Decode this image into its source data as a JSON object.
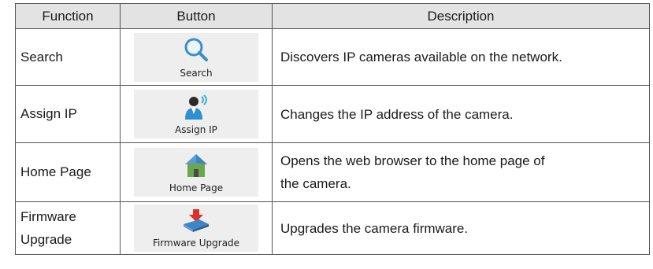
{
  "table": {
    "headers": {
      "function": "Function",
      "button": "Button",
      "description": "Description"
    },
    "rows": [
      {
        "function": "Search",
        "button_label": "Search",
        "icon": "magnifier-icon",
        "description": "Discovers IP cameras available on the network."
      },
      {
        "function": "Assign IP",
        "button_label": "Assign IP",
        "icon": "person-signal-icon",
        "description": "Changes the IP address of the camera."
      },
      {
        "function": "Home Page",
        "button_label": "Home Page",
        "icon": "house-icon",
        "description_line1": "Opens the web browser to the home page of",
        "description_line2": "the camera."
      },
      {
        "function_line1": "Firmware",
        "function_line2": "Upgrade",
        "button_label": "Firmware Upgrade",
        "icon": "chip-download-icon",
        "description": "Upgrades the camera firmware."
      }
    ]
  },
  "colors": {
    "header_bg": "#e3e3e3",
    "button_bg": "#eeeeee",
    "border": "#555555"
  }
}
